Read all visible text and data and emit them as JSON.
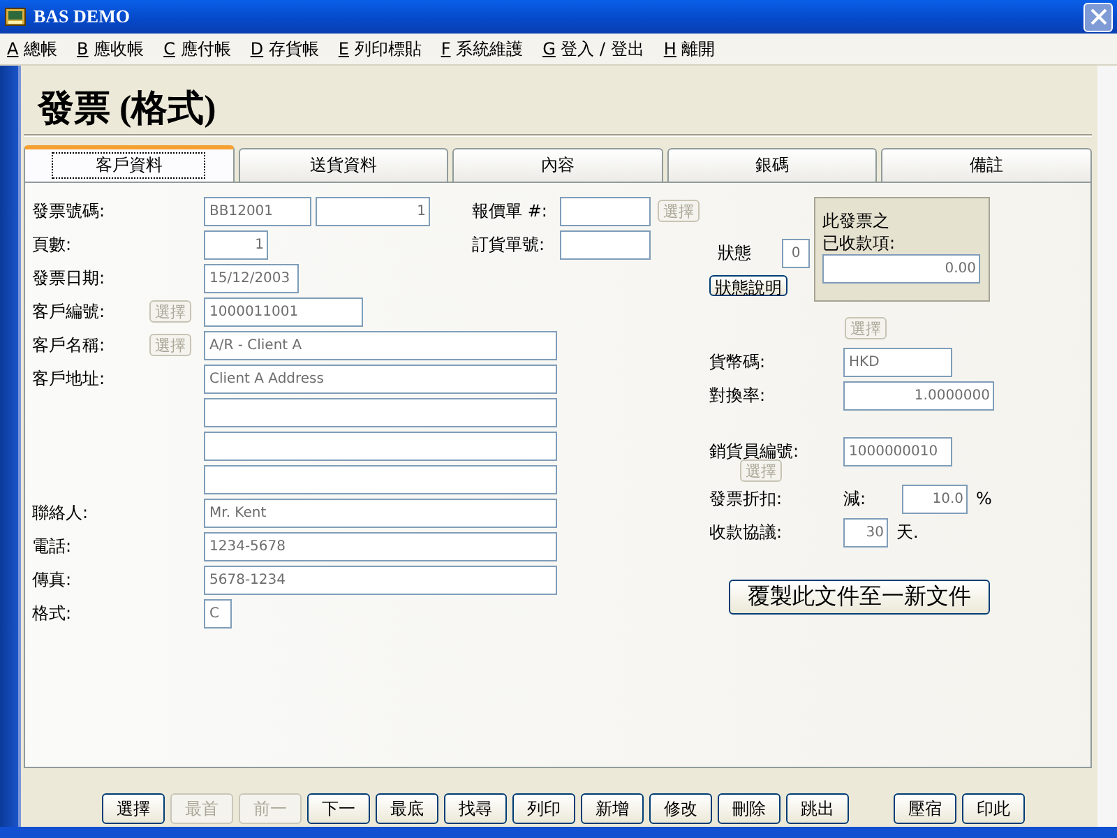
{
  "window": {
    "title": "BAS DEMO"
  },
  "menu": [
    {
      "key": "A",
      "label": "總帳"
    },
    {
      "key": "B",
      "label": "應收帳"
    },
    {
      "key": "C",
      "label": "應付帳"
    },
    {
      "key": "D",
      "label": "存貨帳"
    },
    {
      "key": "E",
      "label": "列印標貼"
    },
    {
      "key": "F",
      "label": "系統維護"
    },
    {
      "key": "G",
      "label": "登入 / 登出"
    },
    {
      "key": "H",
      "label": "離開"
    }
  ],
  "form_title": "發票 (格式)",
  "tabs": [
    {
      "label": "客戶資料",
      "selected": true
    },
    {
      "label": "送貨資料",
      "selected": false
    },
    {
      "label": "內容",
      "selected": false
    },
    {
      "label": "銀碼",
      "selected": false
    },
    {
      "label": "備註",
      "selected": false
    }
  ],
  "customer": [
    {
      "label": "發票號碼:",
      "inputs": [
        {
          "kind": "text",
          "value": "BB12001"
        },
        {
          "kind": "number",
          "value": "1"
        }
      ]
    },
    {
      "label": "頁數:",
      "inputs": [
        {
          "kind": "number",
          "value": "1"
        }
      ]
    },
    {
      "label": "發票日期:",
      "inputs": [
        {
          "kind": "text",
          "value": "15/12/2003"
        }
      ]
    },
    {
      "label": "客戶編號:",
      "select": {
        "label": "選擇",
        "disabled": true
      },
      "inputs": [
        {
          "kind": "text",
          "value": "1000011001"
        }
      ]
    },
    {
      "label": "客戶名稱:",
      "select": {
        "label": "選擇",
        "disabled": true
      },
      "inputs": [
        {
          "kind": "text",
          "value": "A/R - Client A"
        }
      ]
    },
    {
      "label": "客戶地址:",
      "inputs": [
        {
          "kind": "text",
          "value": "Client A Address"
        }
      ]
    },
    {
      "inputs": [
        {
          "kind": "text"
        }
      ]
    },
    {
      "inputs": [
        {
          "kind": "text"
        }
      ]
    },
    {
      "inputs": [
        {
          "kind": "text"
        }
      ]
    },
    {
      "label": "聯絡人:",
      "inputs": [
        {
          "kind": "text",
          "value": "Mr. Kent"
        }
      ]
    },
    {
      "label": "電話:",
      "inputs": [
        {
          "kind": "text",
          "value": "1234-5678"
        }
      ]
    },
    {
      "label": "傳真:",
      "inputs": [
        {
          "kind": "text",
          "value": "5678-1234"
        }
      ]
    },
    {
      "label": "格式:",
      "inputs": [
        {
          "kind": "text",
          "value": "C"
        }
      ]
    }
  ],
  "order_refs": [
    {
      "label": "報價單 #:",
      "select": {
        "label": "選擇",
        "disabled": true
      }
    },
    {
      "label": "訂貨單號:"
    }
  ],
  "status": {
    "label": "狀態",
    "value": "0",
    "button": "狀態說明"
  },
  "received": {
    "caption": [
      "此發票之",
      "已收款項:"
    ],
    "value": "0.00"
  },
  "currency_select": {
    "label": "選擇",
    "disabled": true
  },
  "currency": {
    "label": "貨幣碼:",
    "value": "HKD"
  },
  "rate": {
    "label": "對換率:",
    "value": "1.0000000"
  },
  "salesman": {
    "label": "銷貨員編號:",
    "value": "1000000010",
    "select": {
      "label": "選擇",
      "disabled": true
    }
  },
  "discount": {
    "label": "發票折扣:",
    "prefix": "減:",
    "value": "10.0",
    "suffix": "%"
  },
  "terms": {
    "label": "收款協議:",
    "value": "30",
    "suffix": "天."
  },
  "copy_button": "覆製此文件至一新文件",
  "toolbar": [
    {
      "label": "選擇",
      "disabled": false
    },
    {
      "label": "最首",
      "disabled": true
    },
    {
      "label": "前一",
      "disabled": true
    },
    {
      "label": "下一",
      "disabled": false
    },
    {
      "label": "最底",
      "disabled": false
    },
    {
      "label": "找尋",
      "disabled": false
    },
    {
      "label": "列印",
      "disabled": false
    },
    {
      "label": "新增",
      "disabled": false
    },
    {
      "label": "修改",
      "disabled": false
    },
    {
      "label": "刪除",
      "disabled": false
    },
    {
      "label": "跳出",
      "disabled": false
    },
    {
      "label": "壓宿",
      "disabled": false
    },
    {
      "label": "印此",
      "disabled": false
    }
  ]
}
